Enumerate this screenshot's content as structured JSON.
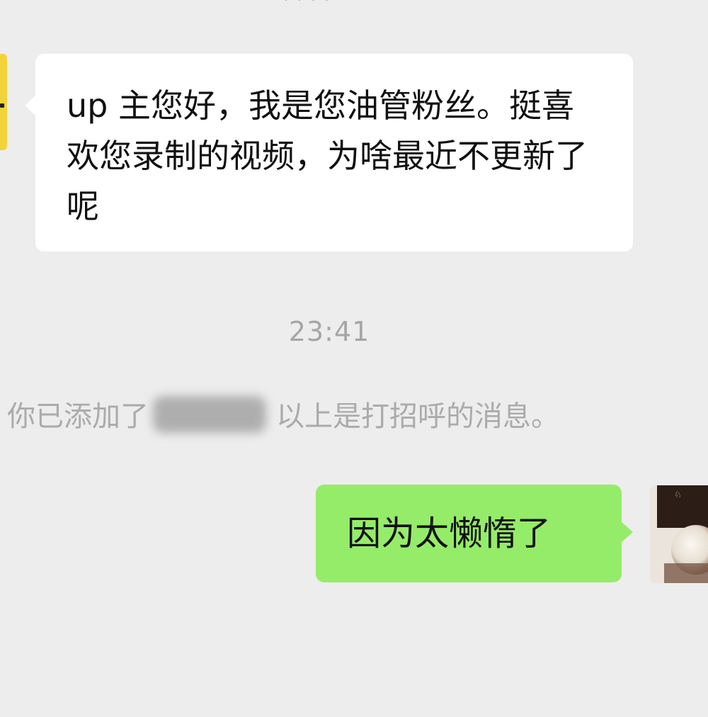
{
  "conversation": {
    "incoming_message": {
      "text": "up 主您好，我是您油管粉丝。挺喜欢您录制的视频，为啥最近不更新了呢"
    },
    "timestamp": "23:41",
    "system_notice": {
      "prefix": "你已添加了",
      "suffix": "以上是打招呼的消息。"
    },
    "outgoing_message": {
      "text": "因为太懒惰了"
    }
  },
  "colors": {
    "background": "#ededed",
    "incoming_bubble": "#ffffff",
    "outgoing_bubble": "#95ec69",
    "meta_text": "#a6a6a6"
  },
  "icons": {
    "incoming_avatar": "yellow-avatar-icon",
    "outgoing_avatar": "dessert-photo-avatar-icon"
  }
}
